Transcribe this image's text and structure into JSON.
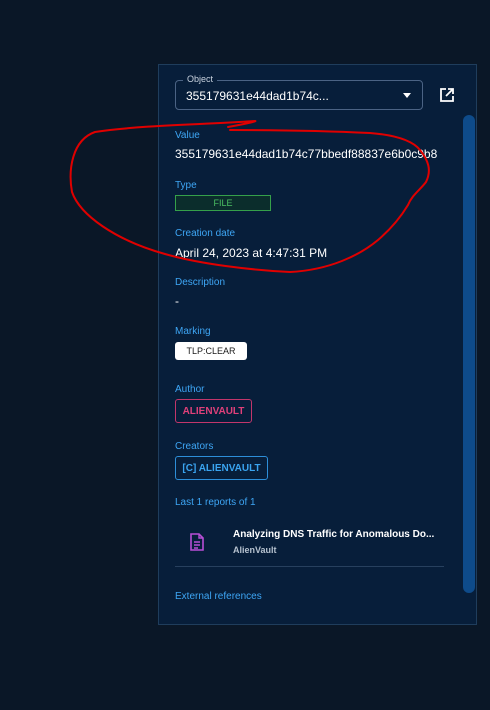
{
  "object_select": {
    "legend": "Object",
    "value": "355179631e44dad1b74c..."
  },
  "fields": {
    "value_label": "Value",
    "value_text": "355179631e44dad1b74c77bbedf88837e6b0c9b8",
    "type_label": "Type",
    "type_chip": "FILE",
    "creation_label": "Creation date",
    "creation_value": "April 24, 2023 at 4:47:31 PM",
    "description_label": "Description",
    "description_value": "-",
    "marking_label": "Marking",
    "marking_chip": "TLP:CLEAR",
    "author_label": "Author",
    "author_chip": "ALIENVAULT",
    "creators_label": "Creators",
    "creators_chip": "[C] ALIENVAULT"
  },
  "reports": {
    "header": "Last 1 reports of 1",
    "items": [
      {
        "title": "Analyzing DNS Traffic for Anomalous Do...",
        "source": "AlienVault"
      }
    ]
  },
  "external_references_label": "External references",
  "colors": {
    "background": "#0a1727",
    "panel": "#071e3a",
    "label_blue": "#3ea6f5",
    "file_green": "#4cc063",
    "author_pink": "#e0407a",
    "scribble_red": "#e00000",
    "report_icon": "#b84fd6"
  },
  "icons": {
    "open_external": "external-link-icon",
    "dropdown": "caret-down-icon",
    "report": "document-icon"
  }
}
